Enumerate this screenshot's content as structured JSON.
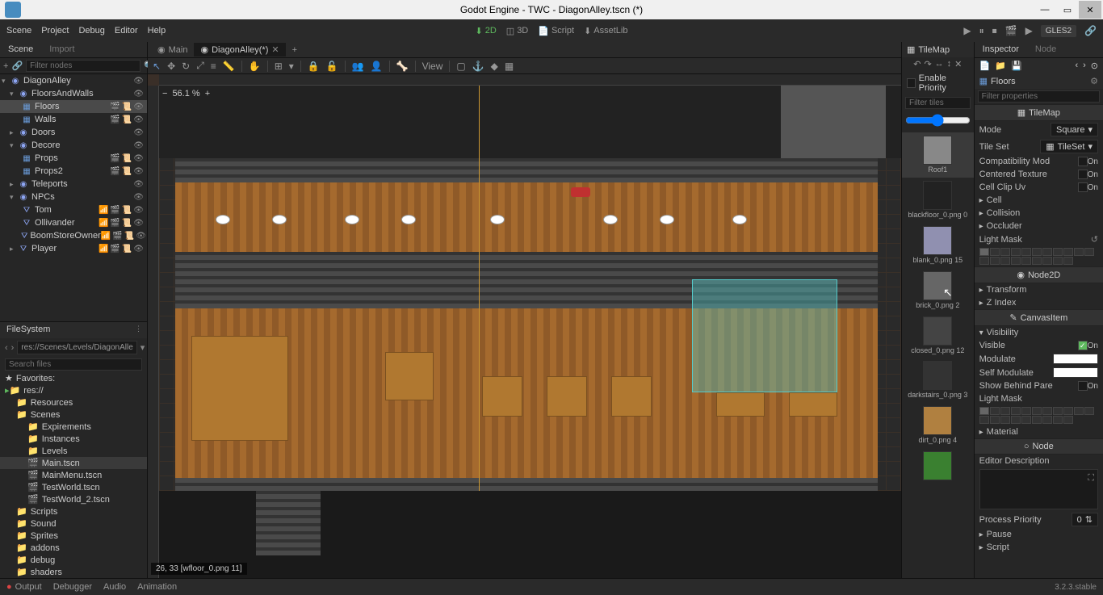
{
  "window": {
    "title": "Godot Engine - TWC - DiagonAlley.tscn (*)"
  },
  "menubar": {
    "items": [
      "Scene",
      "Project",
      "Debug",
      "Editor",
      "Help"
    ],
    "workspaces": {
      "twoD": "2D",
      "threeD": "3D",
      "script": "Script",
      "assetlib": "AssetLib"
    },
    "gles": "GLES2"
  },
  "scene_panel": {
    "tab_scene": "Scene",
    "tab_import": "Import",
    "filter_placeholder": "Filter nodes",
    "tree": {
      "root": "DiagonAlley",
      "floorsAndWalls": "FloorsAndWalls",
      "floors": "Floors",
      "walls": "Walls",
      "doors": "Doors",
      "decore": "Decore",
      "props": "Props",
      "props2": "Props2",
      "teleports": "Teleports",
      "npcs": "NPCs",
      "tom": "Tom",
      "ollivander": "Ollivander",
      "boomStoreOwner": "BoomStoreOwner",
      "player": "Player"
    }
  },
  "filesystem": {
    "title": "FileSystem",
    "path": "res://Scenes/Levels/DiagonAlle",
    "search_placeholder": "Search files",
    "favorites": "Favorites:",
    "root": "res://",
    "folders": {
      "resources": "Resources",
      "scenes": "Scenes",
      "expirements": "Expirements",
      "instances": "Instances",
      "levels": "Levels",
      "scripts": "Scripts",
      "sound": "Sound",
      "sprites": "Sprites",
      "addons": "addons",
      "debug": "debug",
      "shaders": "shaders"
    },
    "files": {
      "main": "Main.tscn",
      "mainMenu": "MainMenu.tscn",
      "testWorld": "TestWorld.tscn",
      "testWorld2": "TestWorld_2.tscn"
    }
  },
  "editor_tabs": {
    "main": "Main",
    "diagonAlley": "DiagonAlley(*)"
  },
  "canvas_toolbar": {
    "view": "View"
  },
  "viewport": {
    "zoom": "56.1 %",
    "status": "26, 33 [wfloor_0.png 11]"
  },
  "tilemap_panel": {
    "title": "TileMap",
    "enable_priority": "Enable Priority",
    "filter_placeholder": "Filter tiles",
    "roof_label": "Roof1",
    "tiles": [
      {
        "name": "blackfloor_0.png 0"
      },
      {
        "name": "blank_0.png 15"
      },
      {
        "name": "brick_0.png 2"
      },
      {
        "name": "closed_0.png 12"
      },
      {
        "name": "darkstairs_0.png 3"
      },
      {
        "name": "dirt_0.png 4"
      }
    ]
  },
  "inspector": {
    "tab_inspector": "Inspector",
    "tab_node": "Node",
    "node_name": "Floors",
    "filter_placeholder": "Filter properties",
    "section_tilemap": "TileMap",
    "props": {
      "mode": "Mode",
      "mode_value": "Square",
      "tileset": "Tile Set",
      "tileset_value": "TileSet",
      "compat": "Compatibility Mod",
      "centered": "Centered Texture",
      "cellclip": "Cell Clip Uv",
      "on": "On"
    },
    "cell": "Cell",
    "collision": "Collision",
    "occluder": "Occluder",
    "light_mask": "Light Mask",
    "section_node2d": "Node2D",
    "transform": "Transform",
    "zindex": "Z Index",
    "section_canvasitem": "CanvasItem",
    "visibility": "Visibility",
    "visible": "Visible",
    "modulate": "Modulate",
    "self_modulate": "Self Modulate",
    "show_behind": "Show Behind Pare",
    "material": "Material",
    "section_node": "Node",
    "editor_desc": "Editor Description",
    "process_priority": "Process Priority",
    "process_priority_value": "0",
    "pause": "Pause",
    "script": "Script"
  },
  "bottom_bar": {
    "output": "Output",
    "debugger": "Debugger",
    "audio": "Audio",
    "animation": "Animation",
    "version": "3.2.3.stable"
  }
}
